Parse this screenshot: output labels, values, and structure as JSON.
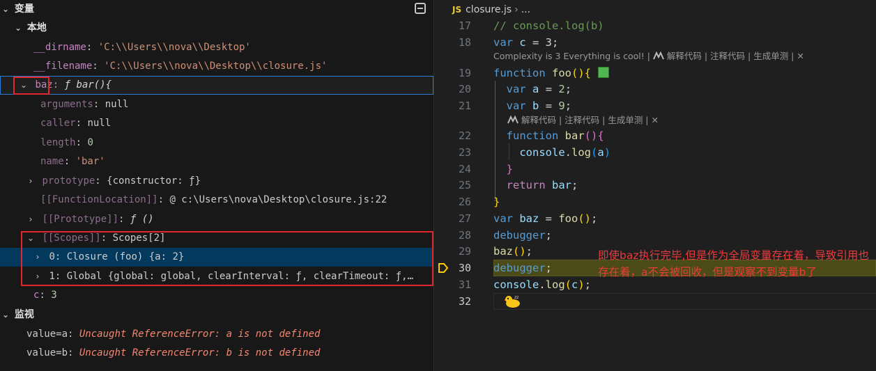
{
  "variables_panel": {
    "title": "变量",
    "local_scope": {
      "label": "本地",
      "dirname": {
        "key": "__dirname",
        "value": "'C:\\\\Users\\\\nova\\\\Desktop'"
      },
      "filename": {
        "key": "__filename",
        "value": "'C:\\\\Users\\\\nova\\\\Desktop\\\\closure.js'"
      },
      "baz": {
        "key": "baz:",
        "value": "ƒ bar(){",
        "children": {
          "arguments": {
            "key": "arguments",
            "value": "null"
          },
          "caller": {
            "key": "caller",
            "value": "null"
          },
          "length": {
            "key": "length",
            "value": "0"
          },
          "name": {
            "key": "name",
            "value": "'bar'"
          },
          "prototype": {
            "key": "prototype",
            "value": "{constructor: ƒ}"
          },
          "function_location": {
            "key": "[[FunctionLocation]]",
            "value": "@ c:\\Users\\nova\\Desktop\\closure.js:22"
          },
          "proto": {
            "key": "[[Prototype]]",
            "value": "ƒ ()"
          },
          "scopes": {
            "key": "[[Scopes]]",
            "value": "Scopes[2]",
            "items": [
              {
                "key": "0",
                "value": "Closure (foo) {a: 2}"
              },
              {
                "key": "1",
                "value": "Global {global: global, clearInterval: ƒ, clearTimeout: ƒ,…"
              }
            ]
          }
        }
      },
      "c": {
        "key": "c",
        "value": "3"
      }
    }
  },
  "watch_panel": {
    "title": "监视",
    "items": [
      {
        "expr": "value=a",
        "error": "Uncaught ReferenceError: a is not defined"
      },
      {
        "expr": "value=b",
        "error": "Uncaught ReferenceError: b is not defined"
      }
    ]
  },
  "editor": {
    "breadcrumb": {
      "icon": "JS",
      "file": "closure.js",
      "rest": "..."
    },
    "line_numbers": [
      "17",
      "18",
      "19",
      "20",
      "21",
      "22",
      "23",
      "24",
      "25",
      "26",
      "27",
      "28",
      "29",
      "30",
      "31",
      "32"
    ],
    "code": {
      "l17": "// console.log(b)",
      "l18_kw": "var",
      "l18_rest": " = 3;",
      "l18_id": "c",
      "l19_kw": "function",
      "l19_fn": "foo",
      "l20_kw": "var",
      "l20_id": "a",
      "l20_num": "2",
      "l21_kw": "var",
      "l21_id": "b",
      "l21_num": "9",
      "l22_kw": "function",
      "l22_fn": "bar",
      "l23_obj": "console",
      "l23_fn": "log",
      "l23_arg": "a",
      "l25_kw": "return",
      "l25_id": "bar",
      "l27_kw": "var",
      "l27_id": "baz",
      "l27_fn": "foo",
      "l28": "debugger",
      "l29_fn": "baz",
      "l30": "debugger",
      "l31_obj": "console",
      "l31_fn": "log",
      "l31_arg": "c"
    },
    "codelens": {
      "line18": "Complexity is 3 Everything is cool! |",
      "line18_actions": "解释代码 | 注释代码 | 生成单测 |",
      "line21_actions": "解释代码 | 注释代码 | 生成单测 |",
      "close": "✕"
    },
    "annotation": "即使baz执行完毕,但是作为全局变量存在着，导致引用也存在着，a不会被回收，但是观察不到变量b了",
    "colors": {
      "annotation": "#f03a3a",
      "current_line": "#4b4b18",
      "accent": "#2b7cd3"
    }
  }
}
